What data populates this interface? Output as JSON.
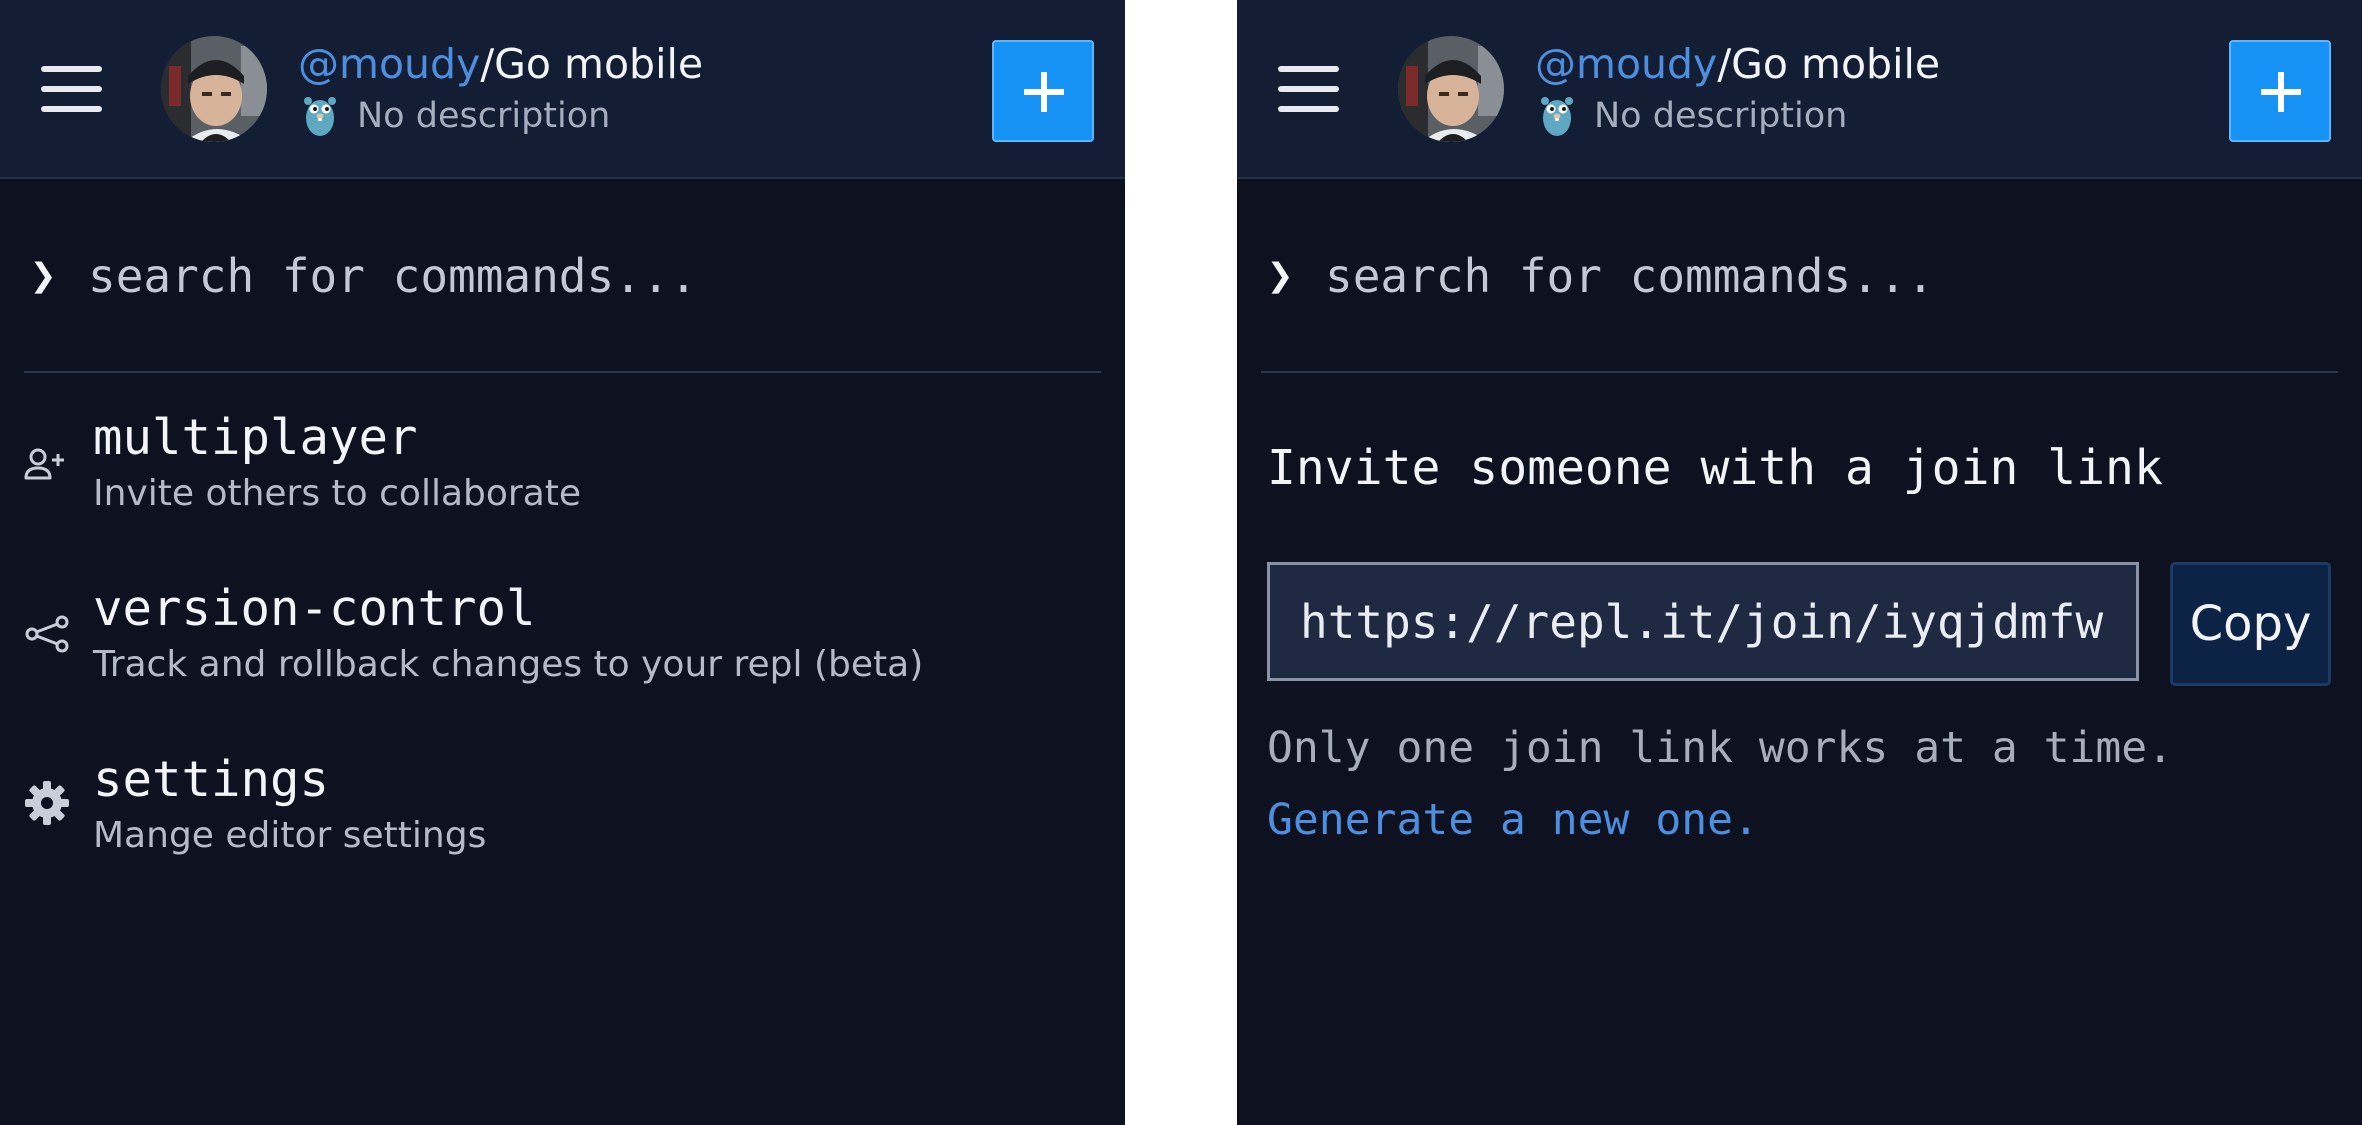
{
  "colors": {
    "panel_background": "#0e1120",
    "header_background": "#131d33",
    "accent_blue": "#1691f4",
    "link_blue": "#4d8fde",
    "copy_button_background": "#0d2346"
  },
  "header": {
    "owner": "@moudy",
    "separator": "/",
    "repl_name": "Go mobile",
    "description": "No description",
    "language_icon": "go-gopher-icon",
    "menu_icon": "hamburger-menu-icon",
    "add_icon": "plus-icon"
  },
  "search": {
    "prompt_glyph": "❯",
    "placeholder": "search for commands..."
  },
  "commands": [
    {
      "name": "multiplayer",
      "description": "Invite others to collaborate",
      "icon": "add-user-icon"
    },
    {
      "name": "version-control",
      "description": "Track and rollback changes to your repl (beta)",
      "icon": "branch-icon"
    },
    {
      "name": "settings",
      "description": "Mange editor settings",
      "icon": "gear-icon"
    }
  ],
  "multiplayer_panel": {
    "heading": "Invite someone with a join link",
    "join_link": "https://repl.it/join/iyqjdmfw-",
    "copy_label": "Copy",
    "note": "Only one join link works at a time.",
    "generate_label": "Generate a new one."
  }
}
